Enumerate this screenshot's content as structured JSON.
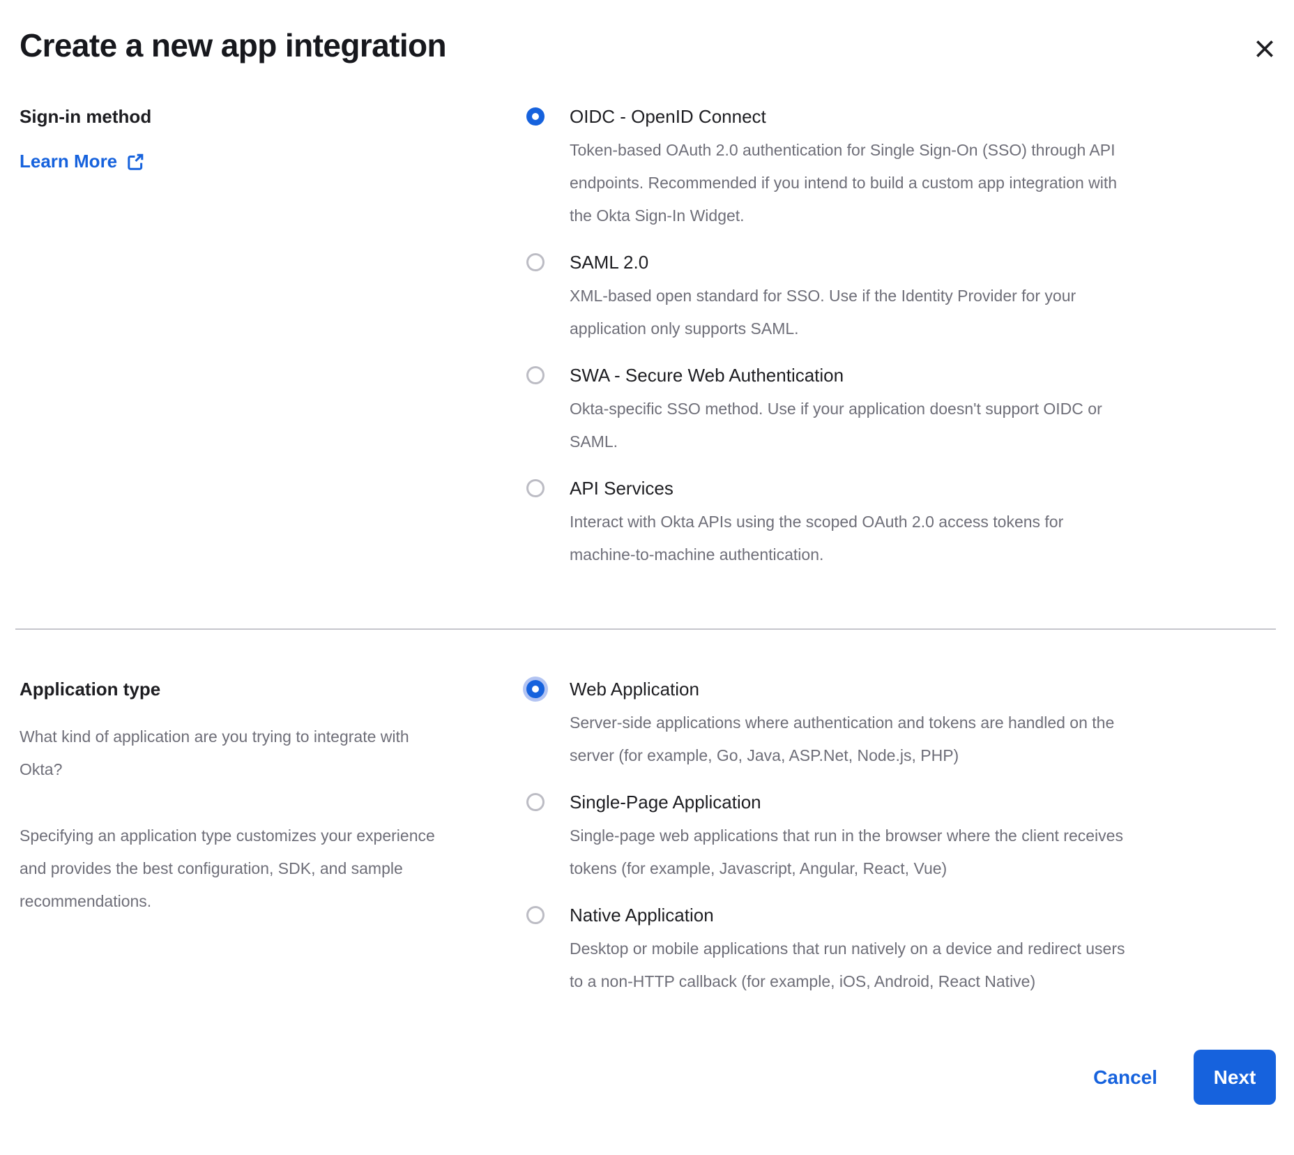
{
  "dialog": {
    "title": "Create a new app integration"
  },
  "sign_in": {
    "label": "Sign-in method",
    "learn_more_label": "Learn More",
    "options": [
      {
        "label": "OIDC - OpenID Connect",
        "description": "Token-based OAuth 2.0 authentication for Single Sign-On (SSO) through API endpoints. Recommended if you intend to build a custom app integration with the Okta Sign-In Widget.",
        "selected": true
      },
      {
        "label": "SAML 2.0",
        "description": "XML-based open standard for SSO. Use if the Identity Provider for your application only supports SAML.",
        "selected": false
      },
      {
        "label": "SWA - Secure Web Authentication",
        "description": "Okta-specific SSO method. Use if your application doesn't support OIDC or SAML.",
        "selected": false
      },
      {
        "label": "API Services",
        "description": "Interact with Okta APIs using the scoped OAuth 2.0 access tokens for machine-to-machine authentication.",
        "selected": false
      }
    ]
  },
  "app_type": {
    "label": "Application type",
    "description_1": "What kind of application are you trying to integrate with Okta?",
    "description_2": "Specifying an application type customizes your experience and provides the best configuration, SDK, and sample recommendations.",
    "options": [
      {
        "label": "Web Application",
        "description": "Server-side applications where authentication and tokens are handled on the server (for example, Go, Java, ASP.Net, Node.js, PHP)",
        "selected": true,
        "focused": true
      },
      {
        "label": "Single-Page Application",
        "description": "Single-page web applications that run in the browser where the client receives tokens (for example, Javascript, Angular, React, Vue)",
        "selected": false
      },
      {
        "label": "Native Application",
        "description": "Desktop or mobile applications that run natively on a device and redirect users to a non-HTTP callback (for example, iOS, Android, React Native)",
        "selected": false
      }
    ]
  },
  "footer": {
    "cancel_label": "Cancel",
    "next_label": "Next"
  },
  "colors": {
    "accent_blue": "#1662dd",
    "text_dark": "#1d1d21",
    "text_gray": "#6e6e78",
    "radio_unselected_border": "#bcbcc4",
    "focus_ring": "#b3c4f2",
    "divider": "#c6c6cc"
  },
  "icons": {
    "close": "close-icon",
    "external_link": "external-link-icon"
  }
}
